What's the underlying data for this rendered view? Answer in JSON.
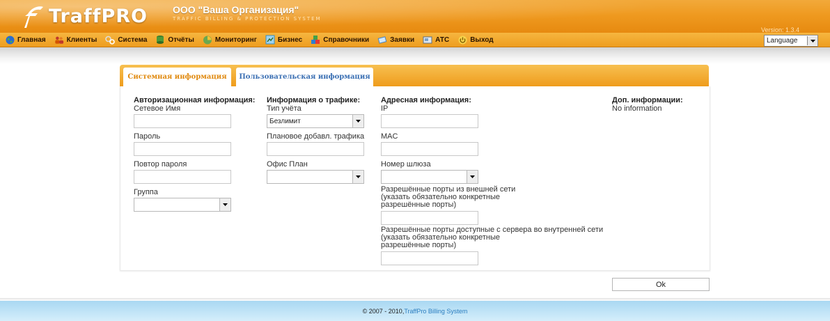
{
  "header": {
    "logo_text": "TraffPRO",
    "org_name": "ООО \"Ваша Организация\"",
    "org_subtitle": "TRAFFIC BILLING & PROTECTION SYSTEM",
    "version": "Version: 1.3.4"
  },
  "menu": {
    "items": [
      {
        "label": "Главная",
        "icon": "globe-icon"
      },
      {
        "label": "Клиенты",
        "icon": "users-icon"
      },
      {
        "label": "Система",
        "icon": "gears-icon"
      },
      {
        "label": "Отчёты",
        "icon": "database-icon"
      },
      {
        "label": "Мониторинг",
        "icon": "monitor-icon"
      },
      {
        "label": "Бизнес",
        "icon": "business-icon"
      },
      {
        "label": "Справочники",
        "icon": "blocks-icon"
      },
      {
        "label": "Заявки",
        "icon": "notes-icon"
      },
      {
        "label": "АТС",
        "icon": "phone-icon"
      },
      {
        "label": "Выход",
        "icon": "power-icon"
      }
    ],
    "language_label": "Language"
  },
  "tabs": {
    "system": "Системная информация",
    "user": "Пользовательская информация"
  },
  "form": {
    "auth": {
      "heading": "Авторизационная информация:",
      "network_name_label": "Сетевое Имя",
      "password_label": "Пароль",
      "password_repeat_label": "Повтор пароля",
      "group_label": "Группа",
      "group_value": ""
    },
    "traffic": {
      "heading": "Информация о трафике:",
      "account_type_label": "Тип учёта",
      "account_type_value": "Безлимит",
      "planned_traffic_label": "Плановое добавл. трафика",
      "office_plan_label": "Офис План",
      "office_plan_value": ""
    },
    "address": {
      "heading": "Адресная информация:",
      "ip_label": "IP",
      "mac_label": "MAC",
      "gateway_label": "Номер шлюза",
      "gateway_value": "",
      "ext_ports_label_1": "Разрешённые порты из внешней сети",
      "ext_ports_label_2": "(указать обязательно конкретные",
      "ext_ports_label_3": "разрешённые порты)",
      "int_ports_label_1": "Разрешённые порты доступные с сервера во внутренней сети",
      "int_ports_label_2": "(указать обязательно конкретные",
      "int_ports_label_3": "разрешённые порты)"
    },
    "extra": {
      "heading": "Доп. информации:",
      "value": "No information"
    },
    "ok_label": "Ok"
  },
  "footer": {
    "copyright": "© 2007 - 2010, ",
    "link": "TraffPro Billing System"
  }
}
